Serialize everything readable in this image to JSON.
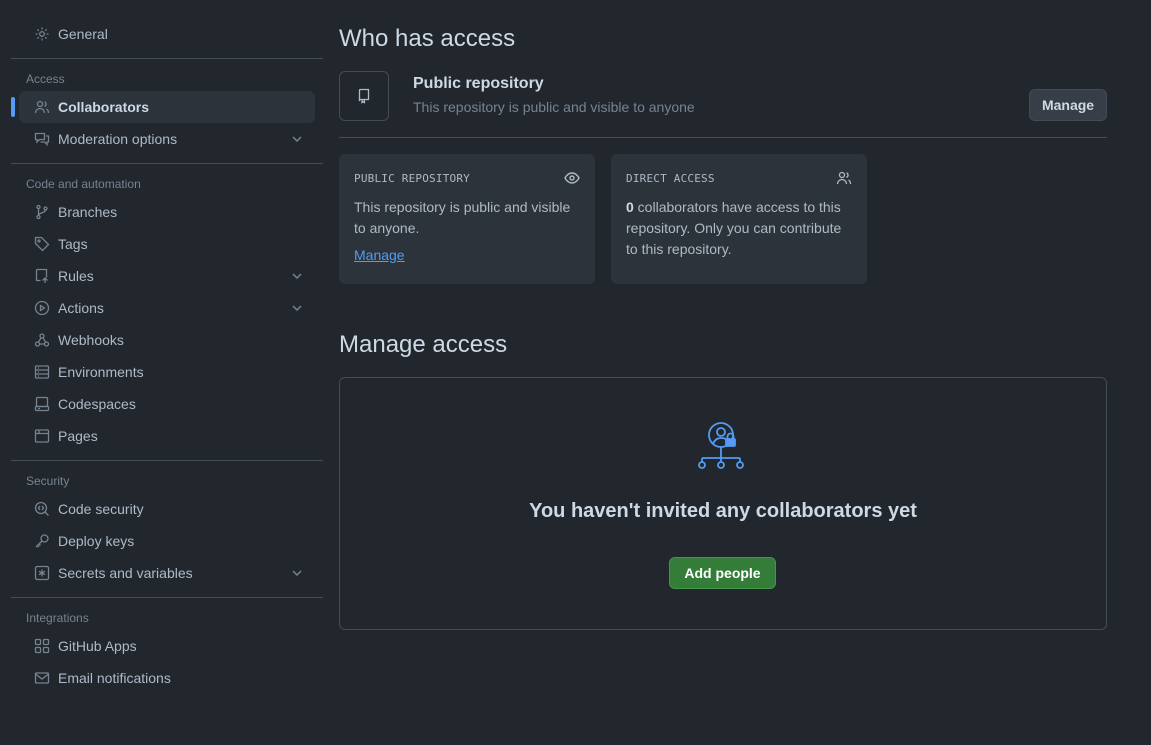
{
  "sidebar": {
    "general": "General",
    "access_title": "Access",
    "collaborators": "Collaborators",
    "moderation": "Moderation options",
    "code_title": "Code and automation",
    "branches": "Branches",
    "tags": "Tags",
    "rules": "Rules",
    "actions": "Actions",
    "webhooks": "Webhooks",
    "environments": "Environments",
    "codespaces": "Codespaces",
    "pages": "Pages",
    "security_title": "Security",
    "code_security": "Code security",
    "deploy_keys": "Deploy keys",
    "secrets": "Secrets and variables",
    "integrations_title": "Integrations",
    "github_apps": "GitHub Apps",
    "email_notifications": "Email notifications"
  },
  "who": {
    "title": "Who has access",
    "repo_name": "Public repository",
    "repo_desc": "This repository is public and visible to anyone",
    "manage_button": "Manage"
  },
  "cards": {
    "public_label": "PUBLIC REPOSITORY",
    "public_text": "This repository is public and visible to anyone.",
    "public_link": "Manage",
    "direct_label": "DIRECT ACCESS",
    "direct_count": "0",
    "direct_text": " collaborators have access to this repository. Only you can contribute to this repository."
  },
  "manage": {
    "title": "Manage access",
    "empty_text": "You haven't invited any collaborators yet",
    "add_button": "Add people"
  },
  "colors": {
    "background": "#22272e",
    "accent": "#539bf5",
    "primary_button": "#347d39"
  }
}
